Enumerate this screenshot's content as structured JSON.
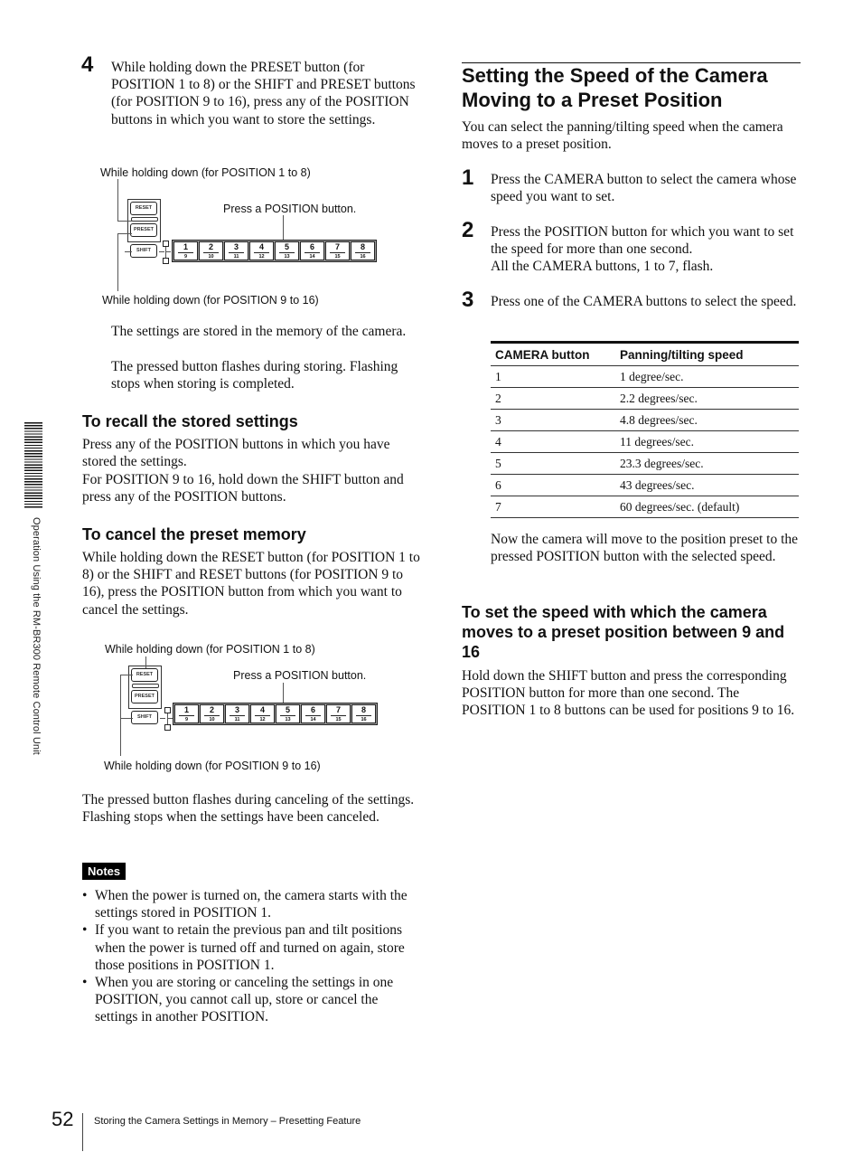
{
  "side_tab": {
    "text": "Operation Using the RM-BR300 Remote Control Unit"
  },
  "left": {
    "step4": {
      "number": "4",
      "text": "While holding down the PRESET button (for POSITION 1 to 8) or the SHIFT and PRESET buttons (for POSITION 9 to 16), press any of the POSITION buttons in which you want to store the settings."
    },
    "diagram1": {
      "caption_top": "While holding down (for POSITION 1 to 8)",
      "caption_press": "Press a POSITION button.",
      "caption_bottom": "While holding down (for POSITION 9 to 16)",
      "buttons": [
        "RESET",
        "PRESET",
        "SHIFT"
      ],
      "positions": [
        {
          "top": "1",
          "bottom": "9"
        },
        {
          "top": "2",
          "bottom": "10"
        },
        {
          "top": "3",
          "bottom": "11"
        },
        {
          "top": "4",
          "bottom": "12"
        },
        {
          "top": "5",
          "bottom": "13"
        },
        {
          "top": "6",
          "bottom": "14"
        },
        {
          "top": "7",
          "bottom": "15"
        },
        {
          "top": "8",
          "bottom": "16"
        }
      ]
    },
    "stored_text_1": "The settings are stored in the memory of the camera.",
    "stored_text_2": "The pressed button flashes during storing. Flashing stops when storing is completed.",
    "recall": {
      "heading": "To recall the stored settings",
      "text1": "Press any of the POSITION buttons in which you have stored the settings.",
      "text2": "For POSITION 9 to 16, hold down the SHIFT button and press any of the POSITION buttons."
    },
    "cancel": {
      "heading": "To cancel the preset memory",
      "text": "While holding down the RESET button (for POSITION 1 to 8) or the SHIFT and RESET buttons (for POSITION 9 to 16), press the POSITION button from which you want to cancel the settings."
    },
    "diagram2": {
      "caption_top": "While holding down (for POSITION 1 to 8)",
      "caption_press": "Press a POSITION button.",
      "caption_bottom": "While holding down (for POSITION 9 to 16)",
      "buttons": [
        "RESET",
        "PRESET",
        "SHIFT"
      ]
    },
    "cancel_result": "The pressed button flashes during canceling of the settings. Flashing stops when the settings have been canceled.",
    "notes": {
      "label": "Notes",
      "items": [
        "When the power is turned on, the camera starts with the settings stored in POSITION 1.",
        "If you want to retain the previous pan and tilt positions when the power is turned off and turned on again, store those positions in POSITION 1.",
        "When you are storing or canceling the settings in one POSITION, you cannot call up, store or cancel the settings in another POSITION."
      ]
    }
  },
  "right": {
    "title": "Setting the Speed of the Camera Moving to a Preset Position",
    "intro": "You can select the panning/tilting speed when the camera moves to a preset position.",
    "steps": [
      {
        "number": "1",
        "text": "Press the CAMERA button to select the camera whose speed you want to set."
      },
      {
        "number": "2",
        "text": "Press the POSITION button for which you want to set the speed for more than one second.",
        "text2": "All the CAMERA buttons, 1 to 7, flash."
      },
      {
        "number": "3",
        "text": "Press one of the CAMERA buttons to select the speed."
      }
    ],
    "table": {
      "headers": [
        "CAMERA button",
        "Panning/tilting speed"
      ],
      "rows": [
        [
          "1",
          "1 degree/sec."
        ],
        [
          "2",
          "2.2 degrees/sec."
        ],
        [
          "3",
          "4.8 degrees/sec."
        ],
        [
          "4",
          "11 degrees/sec."
        ],
        [
          "5",
          "23.3 degrees/sec."
        ],
        [
          "6",
          "43 degrees/sec."
        ],
        [
          "7",
          "60 degrees/sec. (default)"
        ]
      ]
    },
    "after_table": "Now the camera will move to the position preset to the pressed POSITION button with the selected speed.",
    "sub": {
      "heading": "To set the speed with which the camera moves to a preset position between 9 and 16",
      "text": "Hold down the SHIFT button and press the corresponding POSITION button for more than one second. The POSITION 1 to 8 buttons can be used for positions 9 to 16."
    }
  },
  "footer": {
    "page_number": "52",
    "section": "Storing the Camera Settings in Memory – Presetting Feature"
  }
}
